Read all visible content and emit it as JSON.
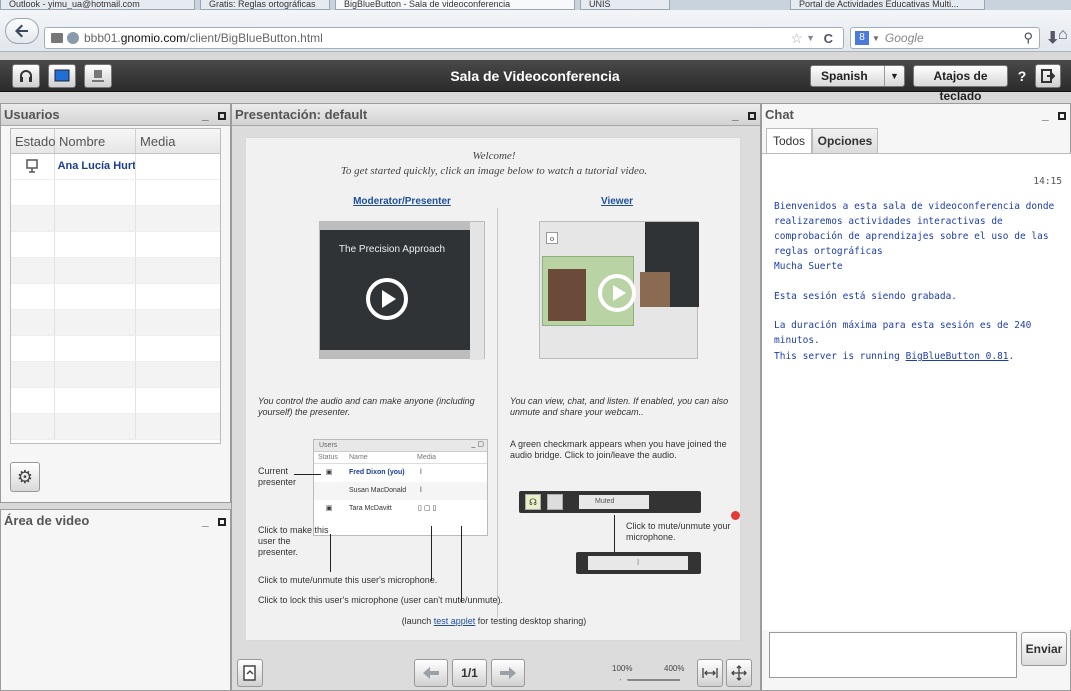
{
  "browser": {
    "tabs": [
      "Outlook - yimu_ua@hotmail.com",
      "Gratis: Reglas ortográficas",
      "BigBlueButton - Sala de videoconferencia",
      "UNIS",
      "Portal de Actividades Educativas Multi...",
      ""
    ],
    "url_prefix": "bbb01.",
    "url_host": "gnomio.com",
    "url_path": "/client/BigBlueButton.html",
    "search_engine": "8",
    "search_placeholder": "Google"
  },
  "toolbar": {
    "title": "Sala de Videoconferencia",
    "language": "Spanish",
    "shortcuts_label": "Atajos de teclado",
    "help_label": "?"
  },
  "users_panel": {
    "title": "Usuarios",
    "columns": [
      "Estado",
      "Nombre",
      "Media"
    ],
    "users": [
      {
        "name": "Ana Lucía Hurtado"
      }
    ]
  },
  "video_panel": {
    "title": "Área de video"
  },
  "presentation": {
    "title": "Presentación: default",
    "slide": {
      "welcome": "Welcome!",
      "intro": "To get started quickly, click an image below to watch a tutorial video.",
      "moderator_heading": "Moderator/Presenter",
      "viewer_heading": "Viewer",
      "thumb_caption": "The Precision Approach",
      "moderator_text": "You control the audio and can make anyone (including yourself) the presenter.",
      "viewer_text": "You can view, chat, and listen.  If enabled, you can also unmute and share your webcam..",
      "users_box_title": "Users",
      "users_box_cols": [
        "Status",
        "Name",
        "Media"
      ],
      "users_box_rows": [
        "Fred Dixon (you)",
        "Susan MacDonald",
        "Tara McDavitt"
      ],
      "current_presenter": "Current presenter",
      "click_make_presenter": "Click to make this user the presenter.",
      "click_mute": "Click to mute/unmute this user's microphone.",
      "click_lock": "Click to lock this user's microphone (user can't mute/unmute).",
      "green_check": "A green checkmark appears when you have joined the audio bridge.  Click to join/leave the audio.",
      "muted_label": "Muted",
      "click_mute_your": "Click to mute/unmute your microphone.",
      "launch_prefix": "(launch ",
      "test_applet": "test applet",
      "launch_suffix": " for testing desktop sharing)"
    },
    "page_indicator": "1/1",
    "zoom_min": "100%",
    "zoom_max": "400%"
  },
  "chat": {
    "title": "Chat",
    "tabs": [
      "Todos",
      "Opciones"
    ],
    "timestamp": "14:15",
    "messages": [
      "Bienvenidos a esta sala de videoconferencia donde realizaremos actividades interactivas de comprobación de aprendizajes sobre el uso de las reglas ortográficas",
      "Mucha Suerte",
      "Esta sesión está siendo grabada.",
      "La duración máxima para esta sesión es de 240 minutos."
    ],
    "server_prefix": "This server is running ",
    "server_link": "BigBlueButton 0.81",
    "server_suffix": ".",
    "send_label": "Enviar"
  },
  "colors": {
    "toolbar_bg": "#333333",
    "link_blue": "#1f3ea8",
    "mic_red": "#e53935"
  }
}
